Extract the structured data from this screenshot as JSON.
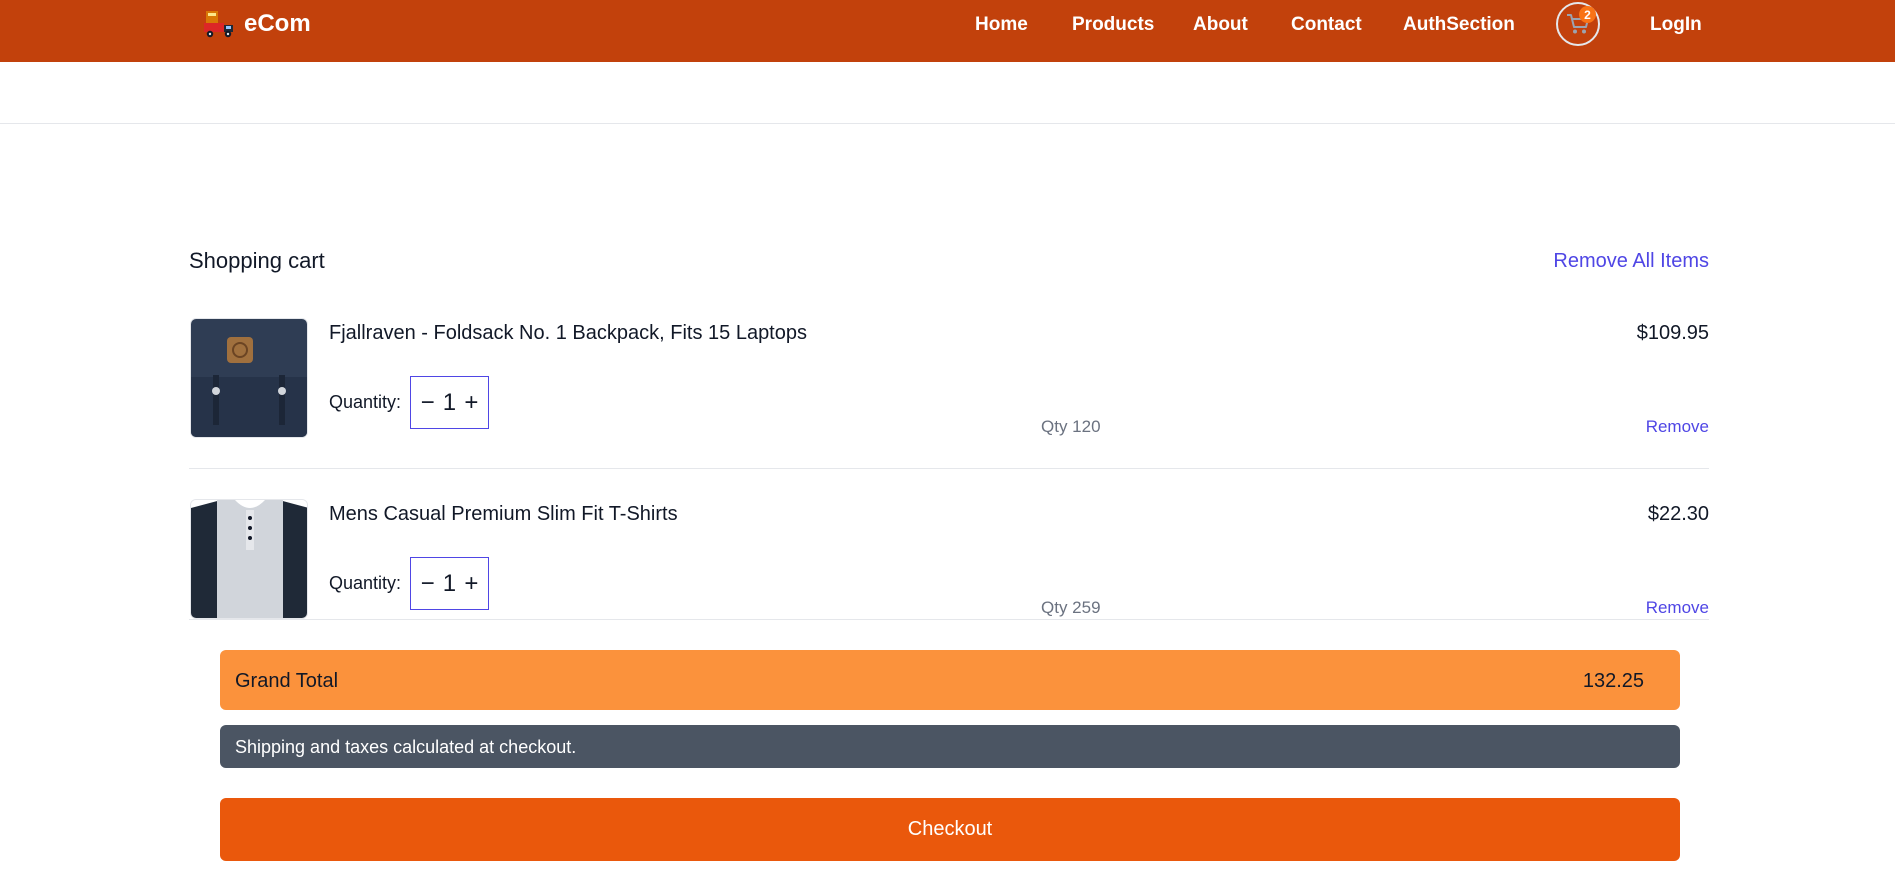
{
  "header": {
    "brand": "eCom",
    "logo_icon": "delivery-truck-icon",
    "nav": [
      {
        "label": "Home"
      },
      {
        "label": "Products"
      },
      {
        "label": "About"
      },
      {
        "label": "Contact"
      },
      {
        "label": "AuthSection"
      }
    ],
    "cart_icon": "shopping-cart-icon",
    "cart_count": "2",
    "login_label": "LogIn",
    "color": "#c2410c"
  },
  "cart": {
    "title": "Shopping cart",
    "remove_all_label": "Remove All Items",
    "items": [
      {
        "name": "Fjallraven - Foldsack No. 1 Backpack, Fits 15 Laptops",
        "price": "$109.95",
        "quantity_label": "Quantity:",
        "quantity": "1",
        "decrement": "−",
        "increment": "+",
        "stock": "Qty 120",
        "remove_label": "Remove",
        "image_icon": "backpack-image"
      },
      {
        "name": "Mens Casual Premium Slim Fit T-Shirts",
        "price": "$22.30",
        "quantity_label": "Quantity:",
        "quantity": "1",
        "decrement": "−",
        "increment": "+",
        "stock": "Qty 259",
        "remove_label": "Remove",
        "image_icon": "tshirt-image"
      }
    ],
    "grand_total_label": "Grand Total",
    "grand_total_value": "132.25",
    "shipping_note": "Shipping and taxes calculated at checkout.",
    "checkout_label": "Checkout",
    "colors": {
      "accent": "#4f46e5",
      "total_bg": "#fb923c",
      "checkout_bg": "#ea580c",
      "note_bg": "#4b5563"
    }
  }
}
